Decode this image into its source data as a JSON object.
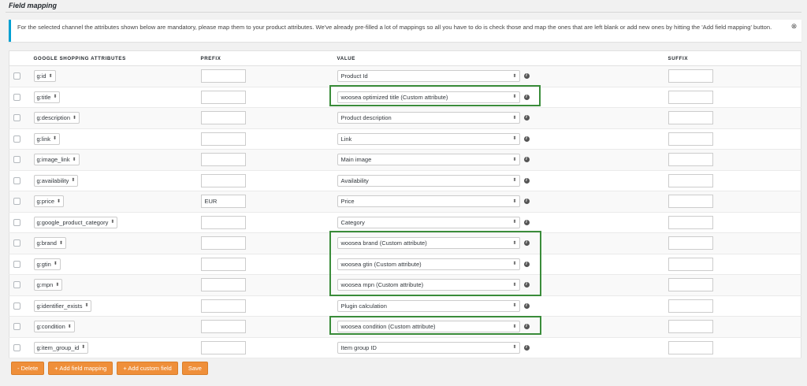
{
  "page": {
    "title": "Field mapping",
    "notice": "For the selected channel the attributes shown below are mandatory, please map them to your product attributes. We've already pre-filled a lot of mappings so all you have to do is check those and map the ones that are left blank or add new ones by hitting the 'Add field mapping' button."
  },
  "table": {
    "headers": {
      "attributes": "GOOGLE SHOPPING ATTRIBUTES",
      "prefix": "PREFIX",
      "value": "VALUE",
      "suffix": "SUFFIX"
    },
    "rows": [
      {
        "attribute": "g:id",
        "prefix": "",
        "value": "Product Id",
        "suffix": ""
      },
      {
        "attribute": "g:title",
        "prefix": "",
        "value": "woosea optimized title (Custom attribute)",
        "suffix": ""
      },
      {
        "attribute": "g:description",
        "prefix": "",
        "value": "Product description",
        "suffix": ""
      },
      {
        "attribute": "g:link",
        "prefix": "",
        "value": "Link",
        "suffix": ""
      },
      {
        "attribute": "g:image_link",
        "prefix": "",
        "value": "Main image",
        "suffix": ""
      },
      {
        "attribute": "g:availability",
        "prefix": "",
        "value": "Availability",
        "suffix": ""
      },
      {
        "attribute": "g:price",
        "prefix": "EUR",
        "value": "Price",
        "suffix": ""
      },
      {
        "attribute": "g:google_product_category",
        "prefix": "",
        "value": "Category",
        "suffix": ""
      },
      {
        "attribute": "g:brand",
        "prefix": "",
        "value": "woosea brand (Custom attribute)",
        "suffix": ""
      },
      {
        "attribute": "g:gtin",
        "prefix": "",
        "value": "woosea gtin (Custom attribute)",
        "suffix": ""
      },
      {
        "attribute": "g:mpn",
        "prefix": "",
        "value": "woosea mpn (Custom attribute)",
        "suffix": ""
      },
      {
        "attribute": "g:identifier_exists",
        "prefix": "",
        "value": "Plugin calculation",
        "suffix": ""
      },
      {
        "attribute": "g:condition",
        "prefix": "",
        "value": "woosea condition (Custom attribute)",
        "suffix": ""
      },
      {
        "attribute": "g:item_group_id",
        "prefix": "",
        "value": "Item group ID",
        "suffix": ""
      }
    ]
  },
  "buttons": {
    "delete": "- Delete",
    "add_field_mapping": "+ Add field mapping",
    "add_custom_field": "+ Add custom field",
    "save": "Save"
  },
  "icons": {
    "info": "info-icon",
    "dismiss": "dismiss-icon",
    "select_arrows": "updown-arrows-icon"
  },
  "colors": {
    "button": "#ef8f3a",
    "highlight": "#3a8c3a",
    "notice_border": "#00a0d2"
  }
}
